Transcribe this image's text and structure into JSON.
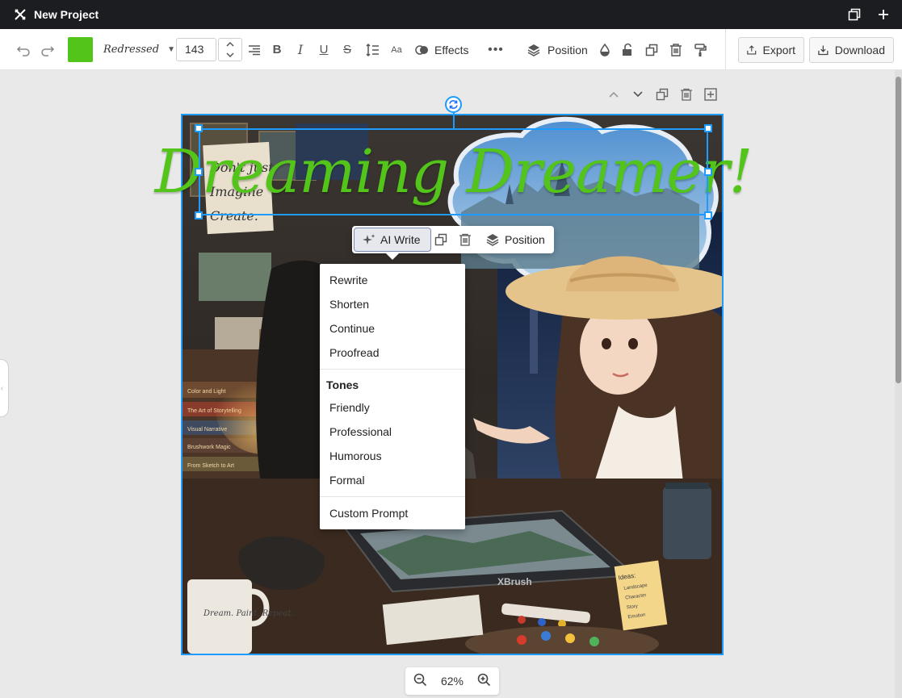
{
  "window": {
    "title": "New Project"
  },
  "toolbar": {
    "font_color": "#52c41a",
    "font_family": "Redressed",
    "font_size": "143",
    "effects_label": "Effects",
    "position_label": "Position",
    "export_label": "Export",
    "download_label": "Download"
  },
  "canvas": {
    "headline": "Dreaming Dreamer!",
    "mug_text": "Dream. Paint. Repeat.",
    "tablet_text": "XBrush",
    "note_title": "Ideas:",
    "note_items": [
      "Landscape",
      "Character",
      "Story",
      "Emotion"
    ],
    "wall_note": [
      "Don't just",
      "Imagine",
      "Create."
    ],
    "book_titles": [
      "Color and Light",
      "The Art of Storytelling",
      "Visual Narrative",
      "Brushwork Magic",
      "From Sketch to Art"
    ]
  },
  "float_toolbar": {
    "ai_write_label": "AI Write",
    "position_label": "Position"
  },
  "ai_menu": {
    "actions": [
      "Rewrite",
      "Shorten",
      "Continue",
      "Proofread"
    ],
    "tones_heading": "Tones",
    "tones": [
      "Friendly",
      "Professional",
      "Humorous",
      "Formal"
    ],
    "custom_label": "Custom Prompt"
  },
  "zoom": {
    "level": "62%"
  }
}
